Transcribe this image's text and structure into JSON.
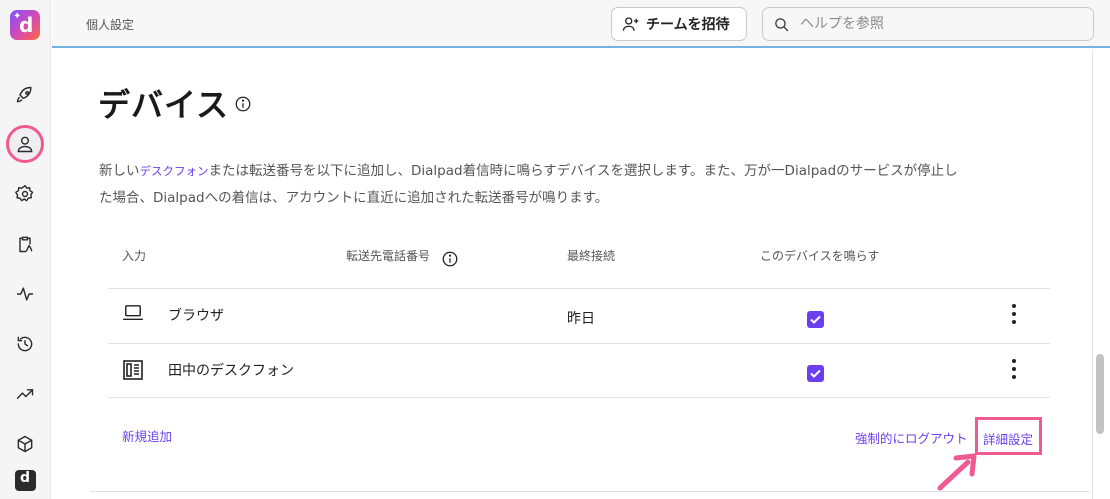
{
  "topbar": {
    "breadcrumb": "個人設定",
    "invite_label": "チームを招待",
    "search_placeholder": "ヘルプを参照"
  },
  "page": {
    "title": "デバイス",
    "description_before": "新しい",
    "description_link": "デスクフォン",
    "description_line1_after": "または転送番号を以下に追加し、Dialpad着信時に鳴らすデバイスを選択します。また、万が一Dialpadのサービスが停止し",
    "description_line2": "た場合、Dialpadへの着信は、アカウントに直近に追加された転送番号が鳴ります。"
  },
  "table": {
    "headers": [
      "入力",
      "転送先電話番号",
      "最終接続",
      "このデバイスを鳴らす"
    ],
    "rows": [
      {
        "name": "ブラウザ",
        "icon": "laptop-icon",
        "forward_number": "",
        "last_connected": "昨日",
        "ring": true
      },
      {
        "name": "田中のデスクフォン",
        "icon": "deskphone-icon",
        "forward_number": "",
        "last_connected": "",
        "ring": true
      }
    ]
  },
  "actions": {
    "add_new": "新規追加",
    "force_logout": "強制的にログアウト",
    "advanced": "詳細設定"
  },
  "colors": {
    "accent": "#6b3ff0",
    "highlight": "#f05a93",
    "topbar_underline": "#74b4e0"
  }
}
